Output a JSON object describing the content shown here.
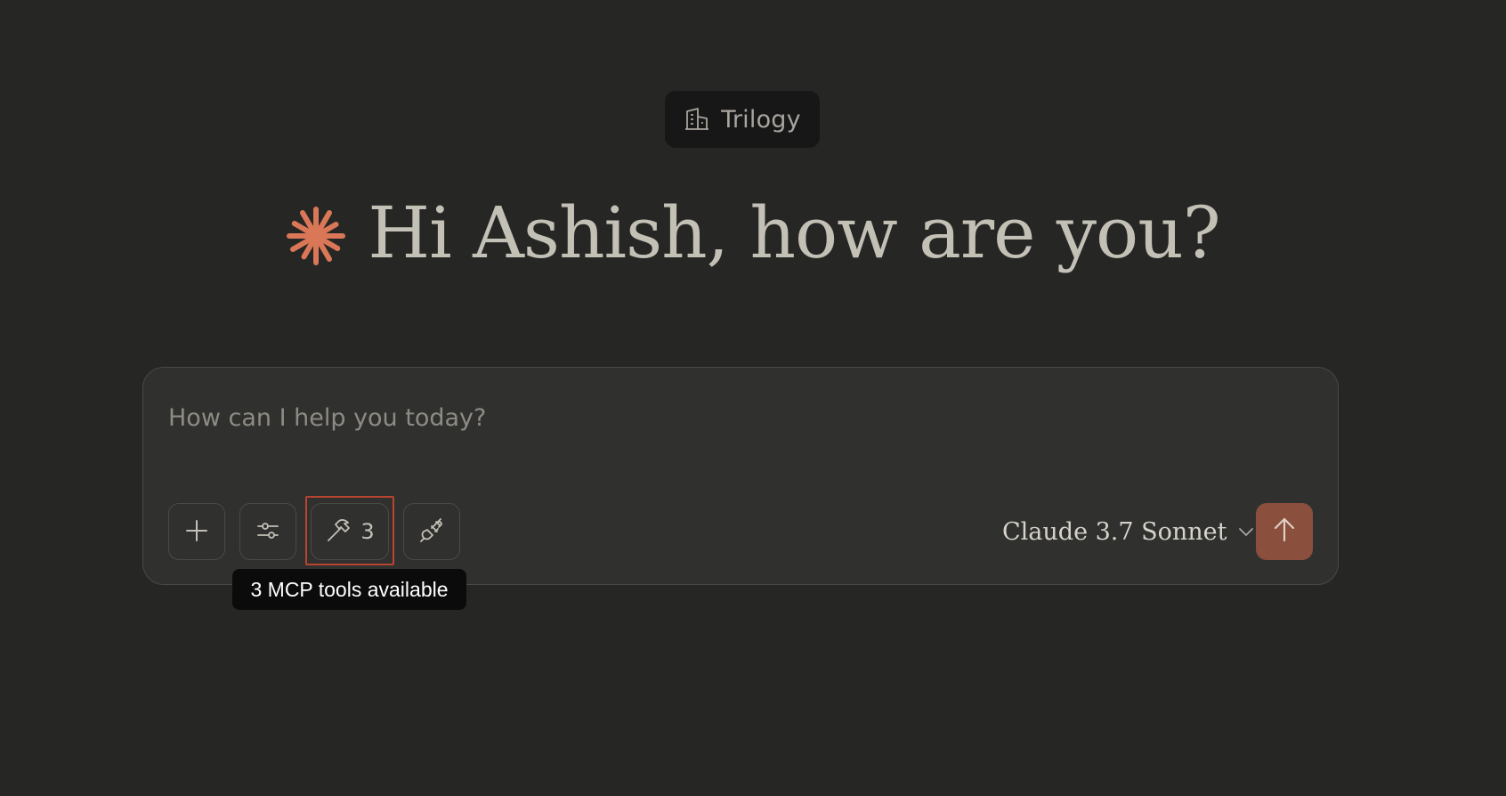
{
  "organization": {
    "name": "Trilogy",
    "icon": "building-icon"
  },
  "greeting": {
    "icon": "claude-starburst-icon",
    "text": "Hi Ashish, how are you?",
    "icon_color": "#d97757"
  },
  "composer": {
    "input_value": "",
    "placeholder": "How can I help you today?",
    "buttons": {
      "add": {
        "icon": "plus-icon"
      },
      "settings": {
        "icon": "sliders-icon"
      },
      "tools": {
        "icon": "hammer-icon",
        "count": "3"
      },
      "integrations": {
        "icon": "plug-icon"
      }
    },
    "model": {
      "label": "Claude 3.7 Sonnet",
      "icon": "chevron-down-icon"
    },
    "send": {
      "icon": "arrow-up-icon",
      "color": "#8a4f3d"
    }
  },
  "tooltip": {
    "text": "3 MCP tools available"
  },
  "colors": {
    "background": "#262624",
    "composer_bg": "#30302e",
    "highlight": "#b8442f"
  }
}
